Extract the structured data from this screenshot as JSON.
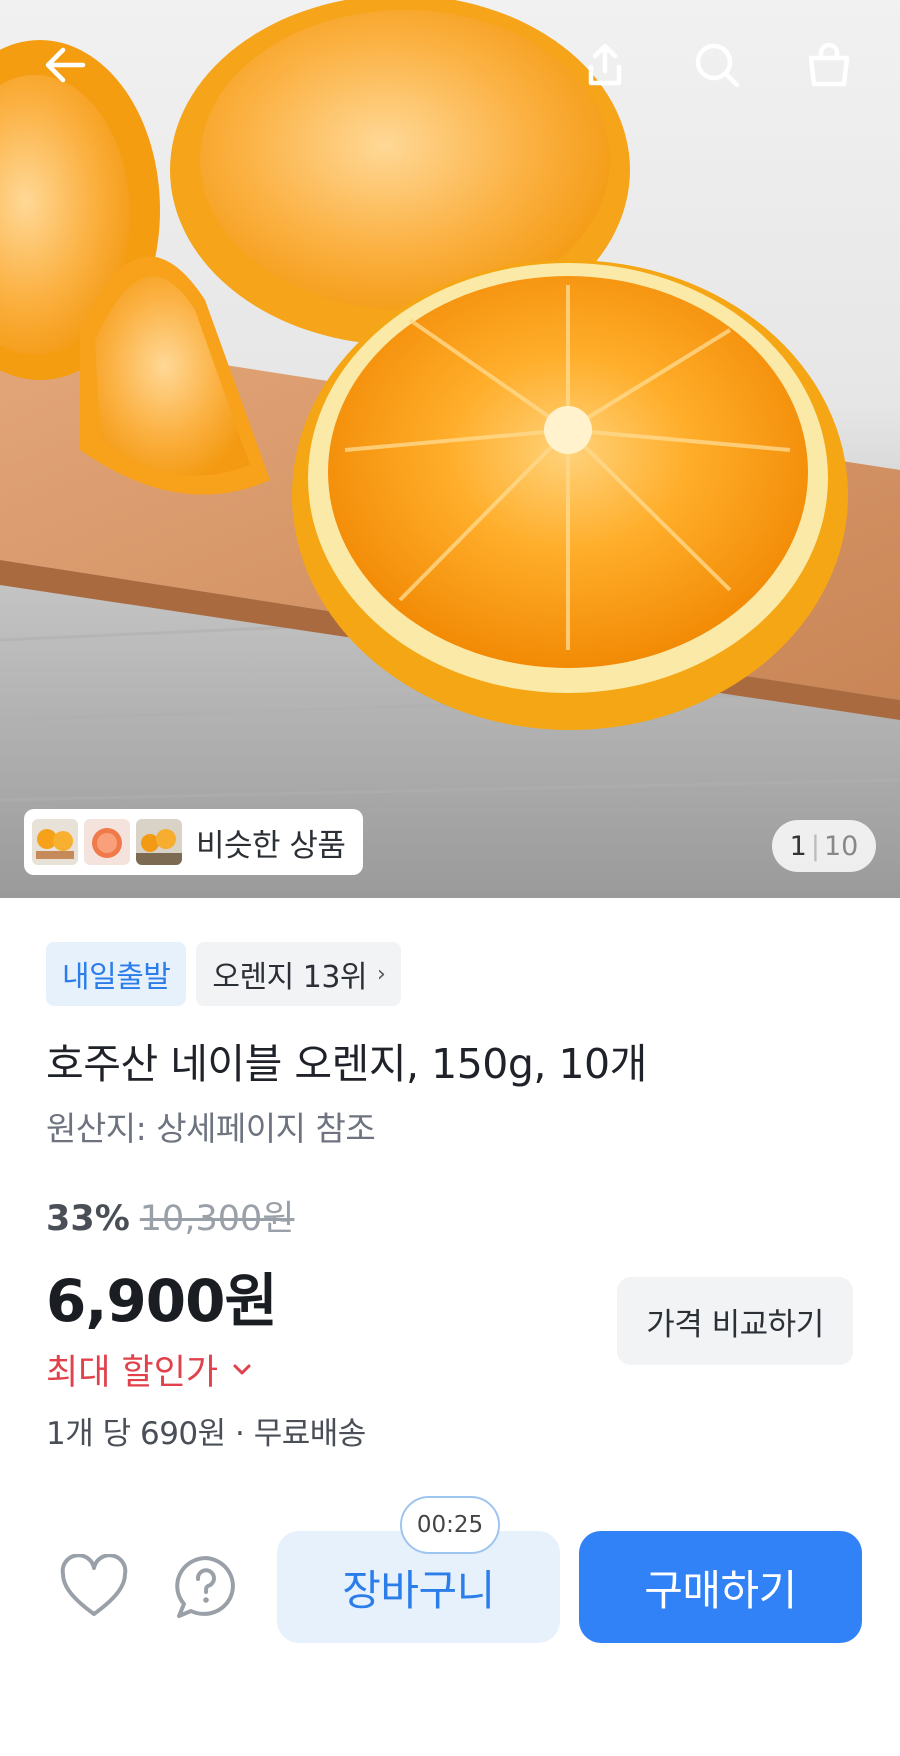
{
  "header": {
    "icons": [
      "back-arrow-icon",
      "share-icon",
      "search-icon",
      "shopping-bag-icon"
    ]
  },
  "gallery": {
    "similar_label": "비슷한 상품",
    "current_index": "1",
    "separator": "|",
    "total": "10"
  },
  "product": {
    "badge_delivery": "내일출발",
    "badge_rank": "오렌지 13위",
    "badge_rank_chevron": "›",
    "title": "호주산 네이블 오렌지, 150g, 10개",
    "origin": "원산지: 상세페이지 참조",
    "discount_rate": "33%",
    "original_price": "10,300원",
    "price": "6,900원",
    "max_discount_label": "최대 할인가",
    "max_discount_chevron": "⌄",
    "unit_price": "1개 당 690원 · 무료배송",
    "compare_label": "가격 비교하기"
  },
  "actions": {
    "timer": "00:25",
    "cart_label": "장바구니",
    "buy_label": "구매하기"
  },
  "colors": {
    "accent_blue": "#3182f6",
    "light_blue": "#e7f1fc",
    "discount_red": "#e0414b"
  }
}
